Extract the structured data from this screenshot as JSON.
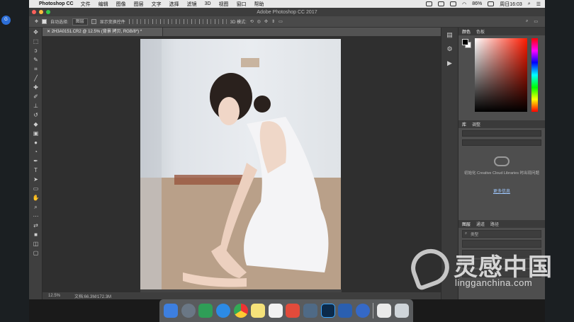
{
  "menubar": {
    "app_name": "Photoshop CC",
    "items": [
      "文件",
      "编辑",
      "图像",
      "图层",
      "文字",
      "选择",
      "滤镜",
      "3D",
      "视图",
      "窗口",
      "帮助"
    ],
    "battery": "86%",
    "clock": "周日16:03"
  },
  "window": {
    "title": "Adobe Photoshop CC 2017"
  },
  "options_bar": {
    "auto_select_label": "自动选择:",
    "auto_select_value": "图层",
    "show_transform_label": "显示变换控件",
    "mode_3d_label": "3D 模式:"
  },
  "document": {
    "tab_label": "2H3A0151.CR2 @ 12.5% (背景 拷贝, RGB/8*) *",
    "zoom": "12.5%",
    "doc_size": "文档:66.3M/172.3M"
  },
  "panels": {
    "color_tabs": [
      "颜色",
      "色板"
    ],
    "library_tabs": [
      "库",
      "调整"
    ],
    "library_message": "初始化 Creative Cloud Libraries 时出现问题",
    "library_link": "更多信息",
    "layers_tabs": [
      "图层",
      "通道",
      "路径"
    ],
    "layers_filter": "类型"
  },
  "watermark": {
    "cn": "灵感中国",
    "en": "lingganchina.com"
  },
  "desktop": {
    "badge": "G"
  },
  "colors": {
    "accent": "#2d6fd8",
    "link": "#9fc8ff"
  }
}
